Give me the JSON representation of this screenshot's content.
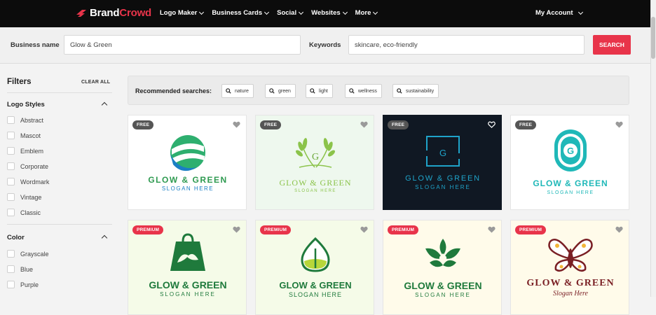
{
  "brand": {
    "part1": "Brand",
    "part2": "Crowd",
    "accent": "#e8344a"
  },
  "nav": {
    "items": [
      "Logo Maker",
      "Business Cards",
      "Social",
      "Websites",
      "More"
    ],
    "account": "My Account"
  },
  "search": {
    "business_label": "Business name",
    "business_value": "Glow & Green",
    "keywords_label": "Keywords",
    "keywords_value": "skincare, eco-friendly",
    "button": "SEARCH"
  },
  "filters": {
    "title": "Filters",
    "clear": "CLEAR ALL",
    "logo_styles_title": "Logo Styles",
    "logo_styles": [
      "Abstract",
      "Mascot",
      "Emblem",
      "Corporate",
      "Wordmark",
      "Vintage",
      "Classic"
    ],
    "color_title": "Color",
    "colors": [
      "Grayscale",
      "Blue",
      "Purple"
    ]
  },
  "recommended": {
    "label": "Recommended searches:",
    "chips": [
      "nature",
      "green",
      "light",
      "wellness",
      "sustainability"
    ]
  },
  "cards": [
    {
      "badge": "FREE",
      "type": "free",
      "title": "GLOW & GREEN",
      "slogan": "SLOGAN HERE"
    },
    {
      "badge": "FREE",
      "type": "free",
      "title": "GLOW & GREEN",
      "slogan": "SLOGAN HERE"
    },
    {
      "badge": "FREE",
      "type": "free",
      "title": "GLOW & GREEN",
      "slogan": "SLOGAN HERE",
      "mono": "G"
    },
    {
      "badge": "FREE",
      "type": "free",
      "title": "GLOW & GREEN",
      "slogan": "SLOGAN HERE",
      "mono": "G"
    },
    {
      "badge": "PREMIUM",
      "type": "premium",
      "title": "GLOW & GREEN",
      "slogan": "SLOGAN HERE"
    },
    {
      "badge": "PREMIUM",
      "type": "premium",
      "title": "GLOW & GREEN",
      "slogan": "SLOGAN HERE"
    },
    {
      "badge": "PREMIUM",
      "type": "premium",
      "title": "GLOW & GREEN",
      "slogan": "SLOGAN HERE"
    },
    {
      "badge": "PREMIUM",
      "type": "premium",
      "title": "GLOW & GREEN",
      "slogan": "Slogan Here"
    }
  ],
  "second_card_mono": "G"
}
